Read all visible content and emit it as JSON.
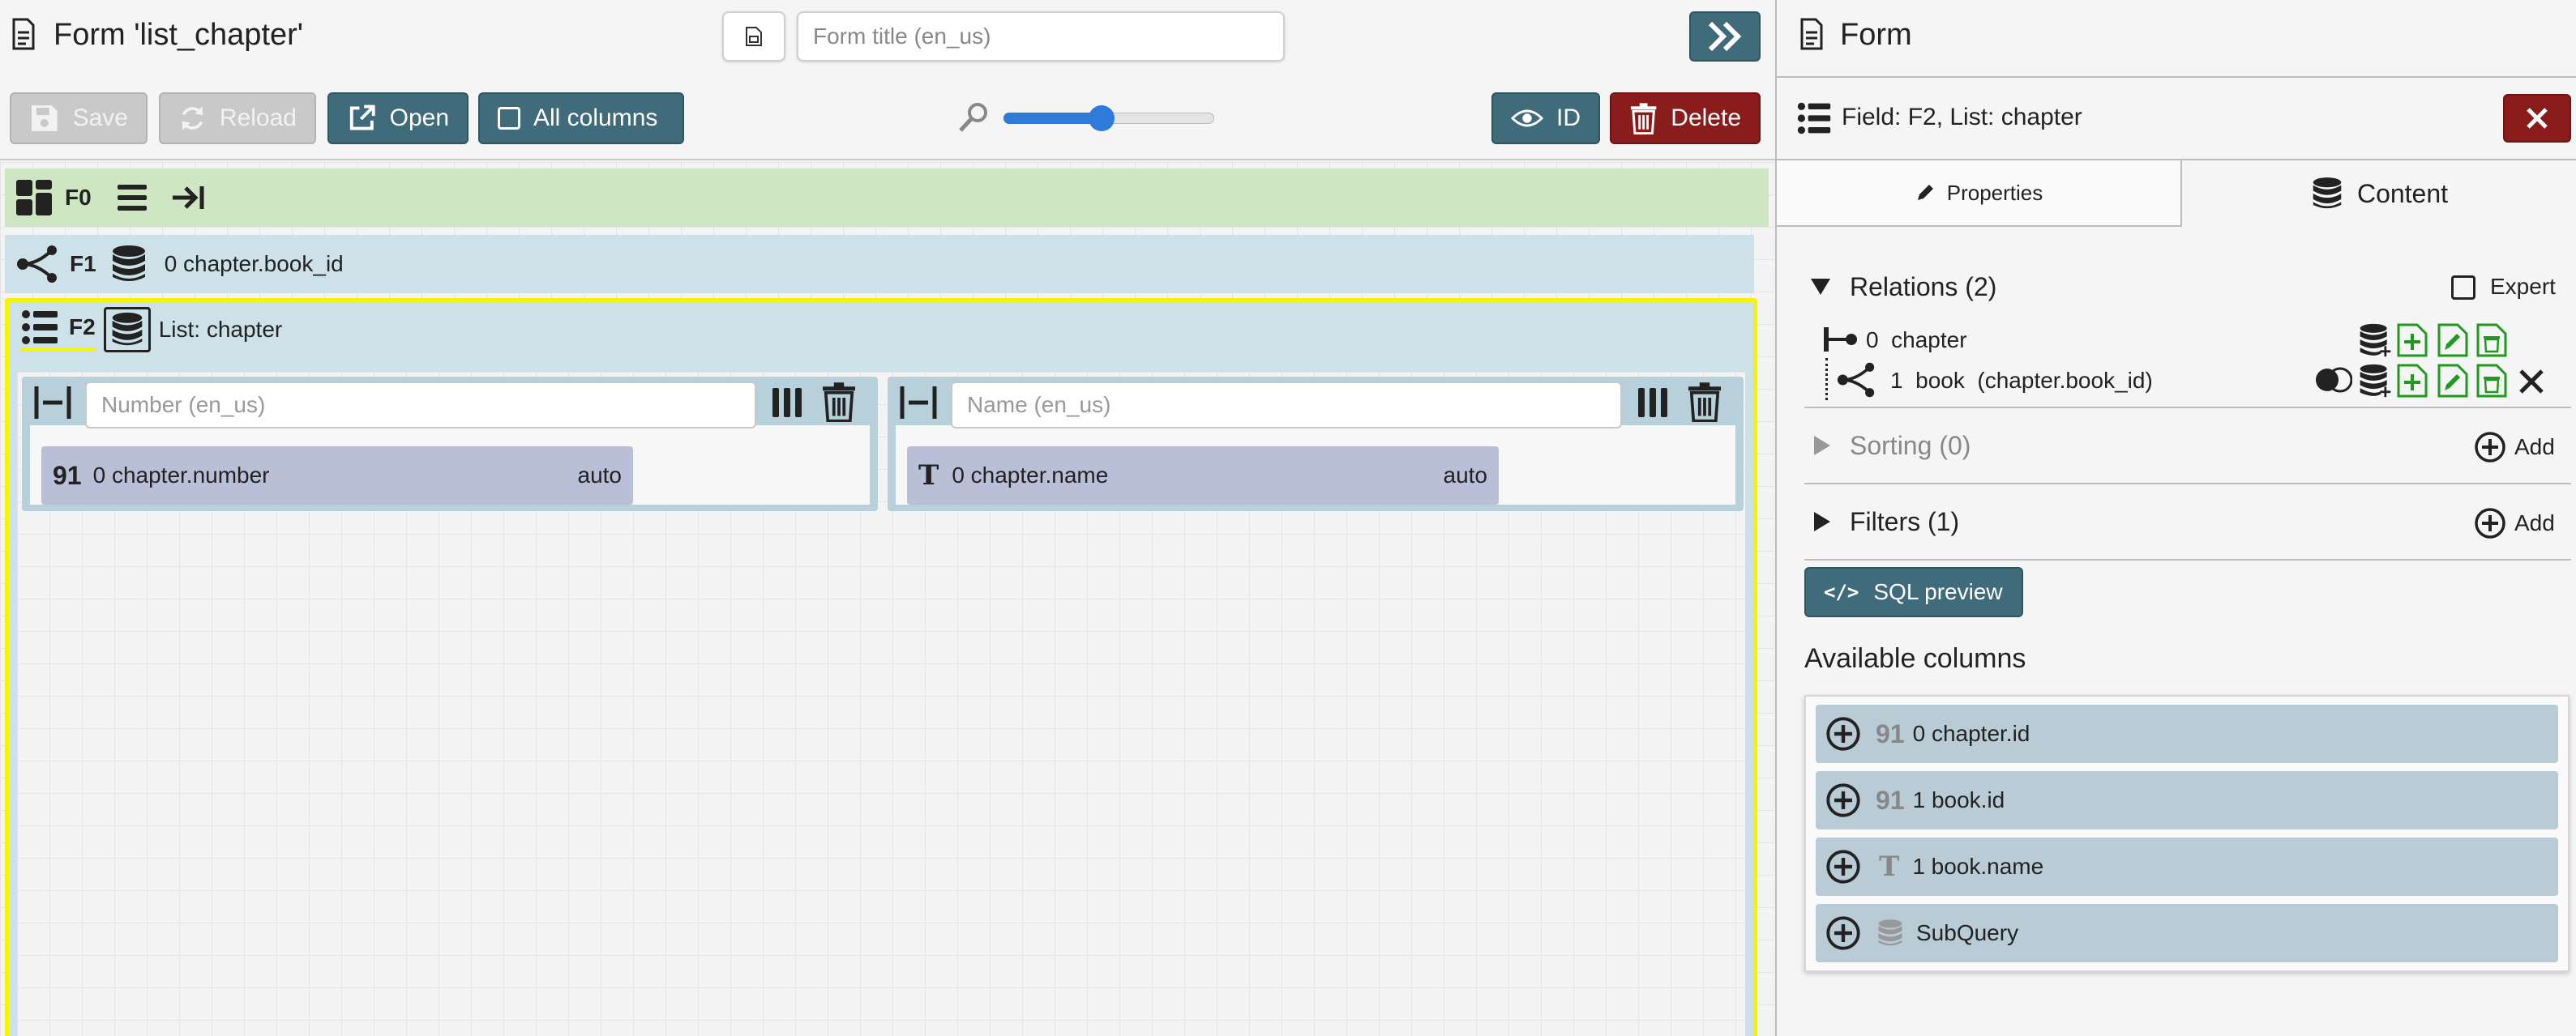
{
  "header": {
    "title": "Form 'list_chapter'",
    "form_title_placeholder": "Form title (en_us)"
  },
  "toolbar": {
    "save_label": "Save",
    "reload_label": "Reload",
    "open_label": "Open",
    "all_columns_label": "All columns",
    "id_label": "ID",
    "delete_label": "Delete",
    "zoom_fraction": 0.46
  },
  "canvas": {
    "f0": {
      "tag": "F0"
    },
    "f1": {
      "tag": "F1",
      "label": "0 chapter.book_id"
    },
    "f2": {
      "tag": "F2",
      "label": "List: chapter",
      "columns": [
        {
          "placeholder": "Number (en_us)",
          "type_icon": "91",
          "field": "0 chapter.number",
          "width": "auto"
        },
        {
          "placeholder": "Name (en_us)",
          "type_icon": "T",
          "field": "0 chapter.name",
          "width": "auto"
        }
      ]
    }
  },
  "panel": {
    "title": "Form",
    "field_title": "Field: F2, List: chapter",
    "tabs": {
      "properties": "Properties",
      "content": "Content"
    },
    "relations": {
      "label": "Relations (2)",
      "expert_label": "Expert",
      "items": [
        {
          "label": "0  chapter"
        },
        {
          "label": "1  book  (chapter.book_id)"
        }
      ]
    },
    "sorting_label": "Sorting (0)",
    "filters_label": "Filters (1)",
    "add_label": "Add",
    "sql_preview_label": "SQL preview",
    "available_columns_label": "Available columns",
    "available_columns": [
      {
        "type_icon": "91",
        "label": "0 chapter.id"
      },
      {
        "type_icon": "91",
        "label": "1 book.id"
      },
      {
        "type_icon": "T",
        "label": "1 book.name"
      },
      {
        "type_icon": "db",
        "label": "SubQuery"
      }
    ]
  },
  "colors": {
    "teal_button": "#3f6b7b",
    "red_button": "#8a1c1c",
    "f0_band": "#cfe6c2",
    "f1_band": "#cde1e8",
    "selection_outline": "#f5f500",
    "column_item": "#b9bfd6",
    "available_item": "#b9ccd6",
    "green_icon": "#1f9a1f"
  }
}
